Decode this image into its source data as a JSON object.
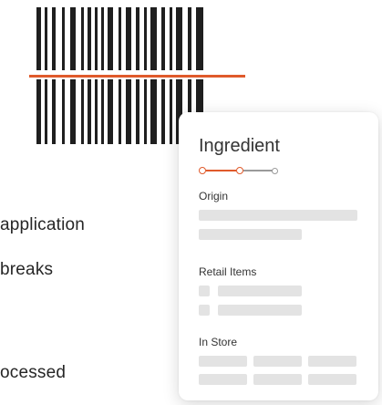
{
  "background_text": [
    "application",
    "breaks",
    "ocessed"
  ],
  "card": {
    "title": "Ingredient",
    "stepper": {
      "steps": 3,
      "current": 2
    },
    "sections": {
      "origin": "Origin",
      "retail": "Retail Items",
      "store": "In Store"
    }
  },
  "colors": {
    "accent": "#e05a2b",
    "inactive": "#9a9a9a",
    "skeleton": "#e3e3e3",
    "barcode": "#1f1f1f"
  }
}
